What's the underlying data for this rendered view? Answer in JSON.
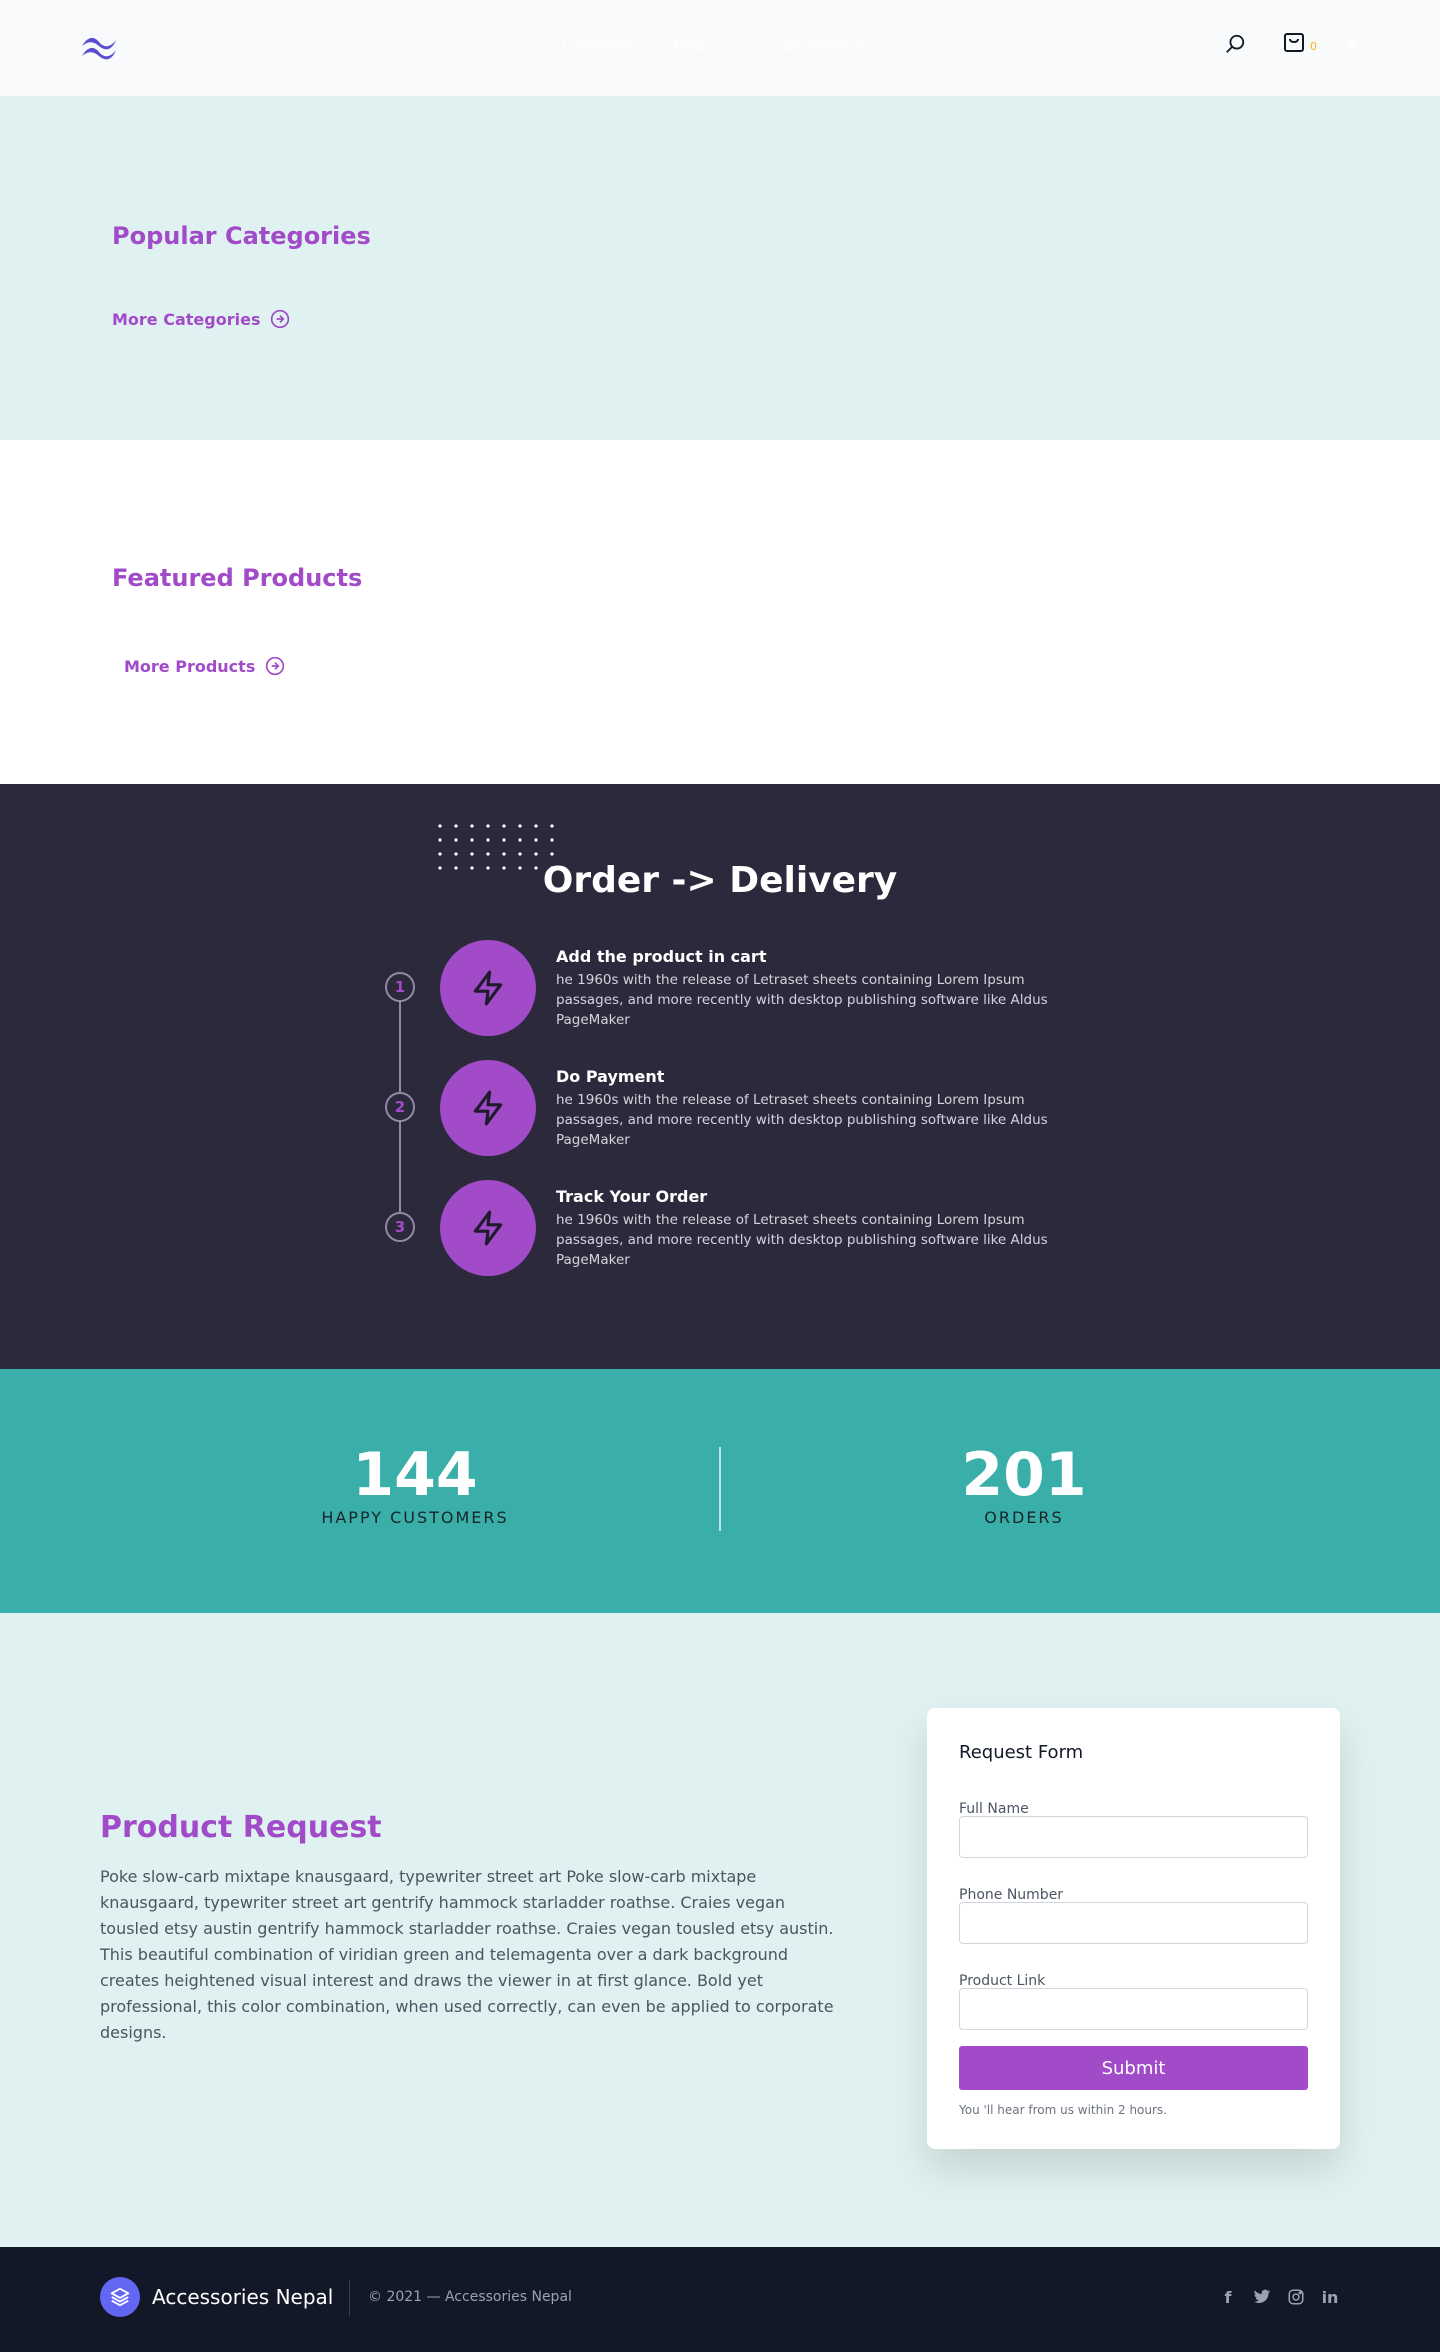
{
  "nav": {
    "links": [
      "Categories",
      "Products",
      "Subcategories"
    ],
    "cart_count": "0"
  },
  "popular": {
    "title": "Popular Categories",
    "more_label": "More Categories"
  },
  "featured": {
    "title": "Featured Products",
    "more_label": "More Products"
  },
  "order": {
    "title": "Order -> Delivery",
    "steps": [
      {
        "num": "1",
        "title": "Add the product in cart",
        "desc": "he 1960s with the release of Letraset sheets containing Lorem Ipsum passages, and more recently with desktop publishing software like Aldus PageMaker"
      },
      {
        "num": "2",
        "title": "Do Payment",
        "desc": "he 1960s with the release of Letraset sheets containing Lorem Ipsum passages, and more recently with desktop publishing software like Aldus PageMaker"
      },
      {
        "num": "3",
        "title": "Track Your Order",
        "desc": "he 1960s with the release of Letraset sheets containing Lorem Ipsum passages, and more recently with desktop publishing software like Aldus PageMaker"
      }
    ]
  },
  "stats": {
    "customers_value": "144",
    "customers_label": "HAPPY CUSTOMERS",
    "orders_value": "201",
    "orders_label": "ORDERS"
  },
  "request": {
    "title": "Product Request",
    "text": "Poke slow-carb mixtape knausgaard, typewriter street art Poke slow-carb mixtape knausgaard, typewriter street art gentrify hammock starladder roathse. Craies vegan tousled etsy austin gentrify hammock starladder roathse. Craies vegan tousled etsy austin. This beautiful combination of viridian green and telemagenta over a dark background creates heightened visual interest and draws the viewer in at first glance. Bold yet professional, this color combination, when used correctly, can even be applied to corporate designs.",
    "form": {
      "title": "Request Form",
      "full_name_label": "Full Name",
      "phone_label": "Phone Number",
      "link_label": "Product Link",
      "full_name_value": "",
      "phone_value": "",
      "link_value": "",
      "submit_label": "Submit",
      "note": "You 'll hear from us within 2 hours."
    }
  },
  "footer": {
    "brand": "Accessories Nepal",
    "copyright": "© 2021 — Accessories Nepal"
  },
  "colors": {
    "accent": "#a24bc9",
    "teal": "#3aafa9",
    "dark": "#2d293d",
    "footer": "#131828"
  }
}
